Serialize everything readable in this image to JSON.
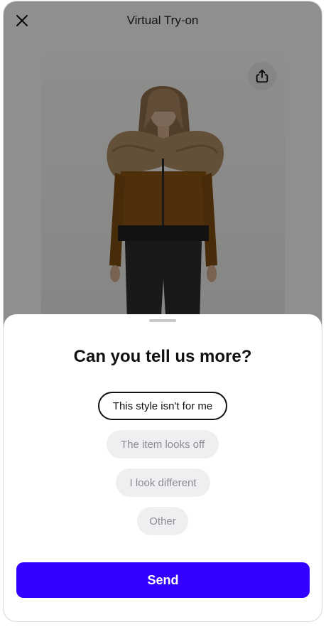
{
  "header": {
    "title": "Virtual Try-on",
    "close_icon": "close-icon"
  },
  "photo": {
    "share_icon": "share-icon",
    "description": "model-wearing-fur-trim-jacket"
  },
  "sheet": {
    "title": "Can you tell us more?",
    "options": [
      {
        "label": "This style isn't for me",
        "selected": true
      },
      {
        "label": "The item looks off",
        "selected": false
      },
      {
        "label": "I look different",
        "selected": false
      },
      {
        "label": "Other",
        "selected": false
      }
    ],
    "send_label": "Send"
  },
  "colors": {
    "accent": "#3300ff",
    "chip_bg": "#efeff1",
    "chip_text": "#8c8c92",
    "scrim": "rgba(0,0,0,0.42)"
  }
}
